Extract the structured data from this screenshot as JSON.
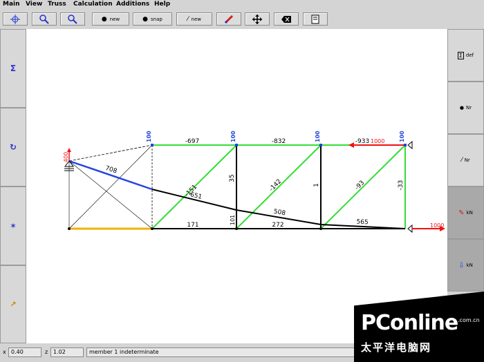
{
  "menu": [
    "Main",
    "View",
    "Truss",
    "Calculation",
    "Additions",
    "Help"
  ],
  "toolbar": {
    "new_label": "new",
    "snap_label": "snap",
    "line_new_label": "new"
  },
  "right_panel": {
    "def_label": "def",
    "nr_label_1": "Nr",
    "nr_label_2": "Nr",
    "kn_label_1": "kN",
    "kn_label_2": "kN"
  },
  "status": {
    "x_label": "x",
    "x_value": "0.40",
    "z_label": "z",
    "z_value": "1.02",
    "message": "member 1 indeterminate"
  },
  "truss": {
    "top_chord": [
      "-697",
      "-832",
      "-933"
    ],
    "bottom_chord": [
      "171",
      "272"
    ],
    "diagonals": [
      "-151",
      "-142",
      "-93"
    ],
    "verticals": [
      "35",
      "1",
      "-33"
    ],
    "cable_forces": [
      "708",
      "651",
      "508",
      "565"
    ],
    "bottom_node_label": "101",
    "support_labels": [
      "100",
      "100",
      "100",
      "100"
    ],
    "left_support_label": "400",
    "load_top": "1000",
    "load_bottom": "1000"
  },
  "colors": {
    "green": "#33dd33",
    "blue": "#2244dd",
    "red": "#ee1111",
    "orange": "#f0b000",
    "black": "#000000"
  },
  "watermark": {
    "brand": "PConline",
    "domain": ".com.cn",
    "subtitle": "太平洋电脑网"
  }
}
